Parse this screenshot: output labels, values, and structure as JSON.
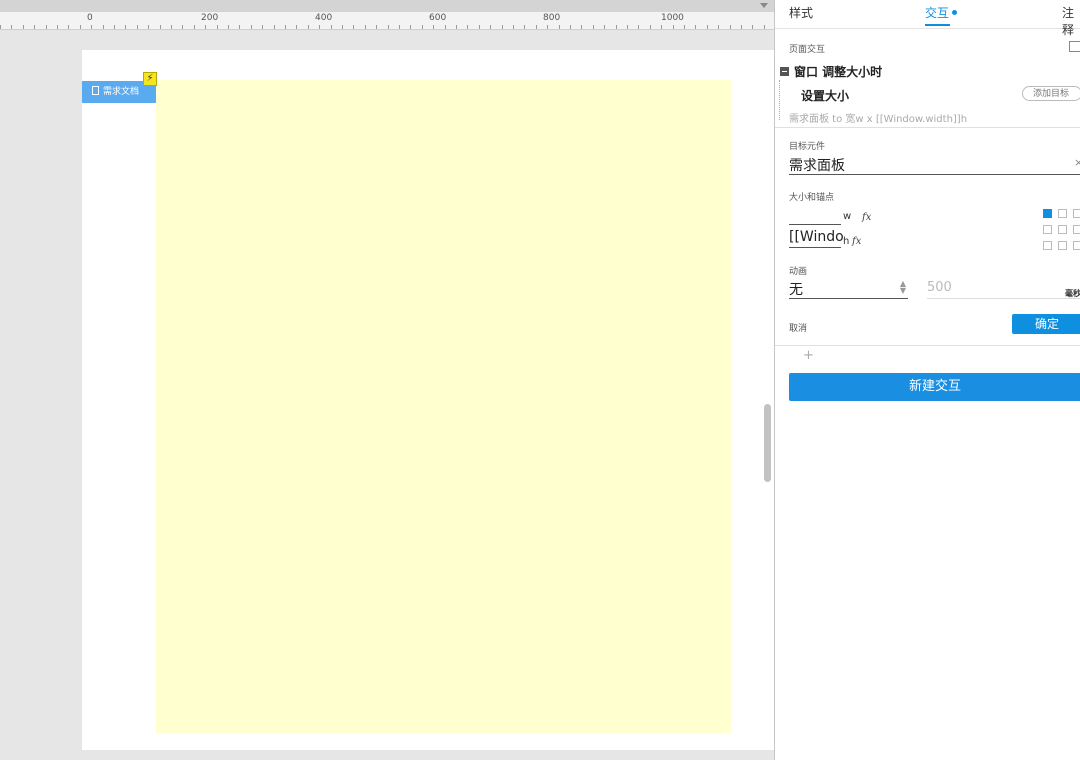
{
  "ruler": {
    "labels": [
      "0",
      "200",
      "400",
      "600",
      "800",
      "1000"
    ]
  },
  "canvas": {
    "tag_label": "需求文档",
    "bolt_icon": "lightning-icon"
  },
  "panel": {
    "tabs": [
      {
        "label": "样式"
      },
      {
        "label": "交互"
      },
      {
        "label": "注释"
      }
    ],
    "page_interaction_label": "页面交互",
    "event_label": "窗口 调整大小时",
    "action_label": "设置大小",
    "add_target_label": "添加目标",
    "action_summary": "需求面板 to 宽w x [[Window.width]]h",
    "target_label": "目标元件",
    "target_value": "需求面板",
    "size_anchor_label": "大小和锚点",
    "width_value": "",
    "width_unit": "w",
    "height_value": "[[Windo",
    "height_unit": "h",
    "fx_label": "fx",
    "animation_label": "动画",
    "animation_value": "无",
    "duration_value": "500",
    "duration_unit": "毫秒",
    "cancel_label": "取消",
    "ok_label": "确定",
    "plus_label": "+",
    "new_interaction_label": "新建交互"
  },
  "colors": {
    "accent": "#0f8fdf",
    "panel_yellow": "#ffffd0",
    "tag_blue": "#5aaaf0"
  }
}
